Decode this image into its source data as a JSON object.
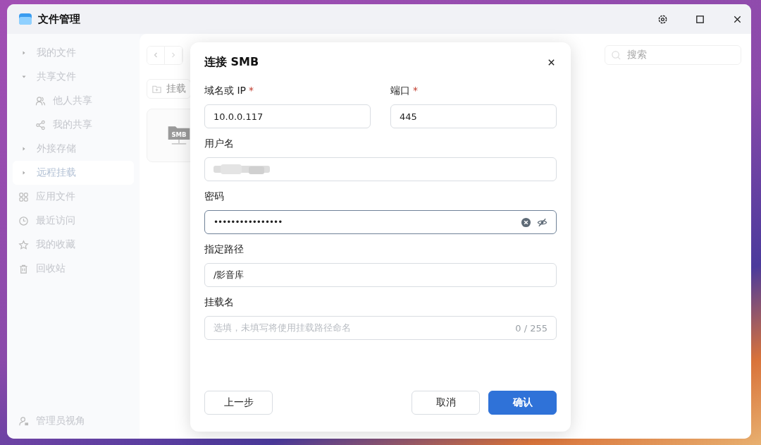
{
  "window": {
    "title": "文件管理"
  },
  "sidebar": {
    "items": [
      {
        "label": "我的文件",
        "kind": "group",
        "expanded": false,
        "selected": false
      },
      {
        "label": "共享文件",
        "kind": "group",
        "expanded": true,
        "selected": false,
        "children": [
          {
            "label": "他人共享",
            "kind": "users",
            "selected": false
          },
          {
            "label": "我的共享",
            "kind": "share",
            "selected": false
          }
        ]
      },
      {
        "label": "外接存储",
        "kind": "group",
        "expanded": false,
        "selected": false
      },
      {
        "label": "远程挂载",
        "kind": "group",
        "expanded": false,
        "selected": true
      },
      {
        "label": "应用文件",
        "kind": "apps",
        "selected": false
      },
      {
        "label": "最近访问",
        "kind": "clock",
        "selected": false
      },
      {
        "label": "我的收藏",
        "kind": "star",
        "selected": false
      },
      {
        "label": "回收站",
        "kind": "trash",
        "selected": false
      }
    ],
    "footer": "管理员视角"
  },
  "toolbar": {
    "mount_button": "挂载",
    "search": {
      "placeholder": "搜索"
    }
  },
  "mount_card": {
    "icon_label": "SMB"
  },
  "dialog": {
    "title": "连接 SMB",
    "rows": [
      [
        {
          "label": "域名或 IP",
          "required_mark": "*",
          "kind": "text",
          "value": "10.0.0.117"
        },
        {
          "label": "端口",
          "required_mark": "*",
          "kind": "text",
          "value": "445"
        }
      ],
      [
        {
          "label": "用户名",
          "kind": "blurred"
        }
      ],
      [
        {
          "label": "密码",
          "kind": "password",
          "value": "••••••••••••••••",
          "focused": true
        }
      ],
      [
        {
          "label": "指定路径",
          "kind": "text",
          "value": "/影音库"
        }
      ],
      [
        {
          "label": "挂载名",
          "kind": "text",
          "placeholder": "选填，未填写将使用挂载路径命名",
          "counter": "0 / 255"
        }
      ]
    ],
    "buttons": [
      {
        "label": "上一步",
        "kind": "secondary"
      },
      {
        "label": "取消",
        "kind": "secondary"
      },
      {
        "label": "确认",
        "kind": "primary"
      }
    ]
  }
}
